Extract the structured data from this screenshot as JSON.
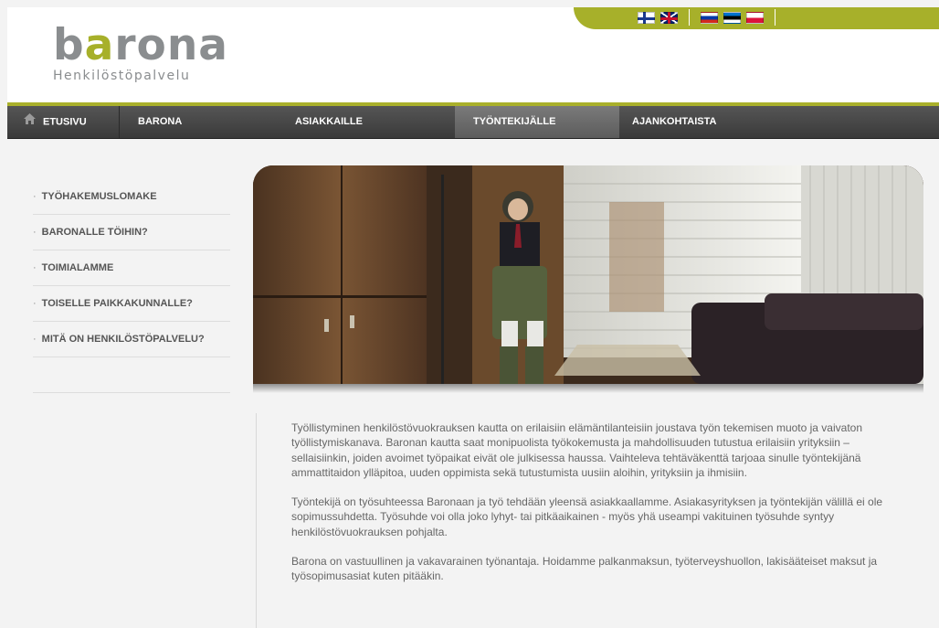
{
  "brand": {
    "name": "barona",
    "tagline": "Henkilöstöpalvelu",
    "colors": {
      "accent": "#a7b02a",
      "logo_gray": "#8a8d8f",
      "nav_bg": "#444444"
    }
  },
  "languages": [
    {
      "code": "fi",
      "icon": "flag-finland-icon"
    },
    {
      "code": "en",
      "icon": "flag-uk-icon"
    },
    {
      "code": "ru",
      "icon": "flag-russia-icon"
    },
    {
      "code": "et",
      "icon": "flag-estonia-icon"
    },
    {
      "code": "pl",
      "icon": "flag-poland-icon"
    }
  ],
  "nav": {
    "items": [
      {
        "label": "ETUSIVU",
        "icon": "home-icon",
        "active": false
      },
      {
        "label": "BARONA",
        "active": false
      },
      {
        "label": "ASIAKKAILLE",
        "active": false
      },
      {
        "label": "TYÖNTEKIJÄLLE",
        "active": true
      },
      {
        "label": "AJANKOHTAISTA",
        "active": false
      }
    ]
  },
  "sidebar": {
    "items": [
      {
        "label": "TYÖHAKEMUSLOMAKE"
      },
      {
        "label": "BARONALLE TÖIHIN?"
      },
      {
        "label": "TOIMIALAMME"
      },
      {
        "label": "TOISELLE PAIKKAKUNNALLE?"
      },
      {
        "label": "MITÄ ON HENKILÖSTÖPALVELU?"
      }
    ]
  },
  "hero": {
    "icon": "office-photo"
  },
  "content": {
    "paragraphs": [
      "Työllistyminen henkilöstövuokrauksen kautta on erilaisiin elämäntilanteisiin joustava työn tekemisen muoto ja vaivaton työllistymiskanava. Baronan kautta saat monipuolista työkokemusta ja mahdollisuuden tutustua erilaisiin yrityksiin – sellaisiinkin, joiden avoimet työpaikat eivät ole julkisessa haussa. Vaihteleva tehtäväkenttä tarjoaa sinulle työntekijänä ammattitaidon ylläpitoa, uuden oppimista sekä tutustumista uusiin aloihin, yrityksiin ja ihmisiin.",
      "Työntekijä on työsuhteessa Baronaan ja työ tehdään yleensä asiakkaallamme. Asiakasyrityksen ja työntekijän välillä ei ole sopimussuhdetta. Työsuhde voi olla joko lyhyt- tai pitkäaikainen - myös yhä useampi vakituinen työsuhde syntyy henkilöstövuokrauksen pohjalta.",
      "Barona on vastuullinen ja vakavarainen työnantaja. Hoidamme palkanmaksun, työterveyshuollon, lakisääteiset maksut ja työsopimusasiat kuten pitääkin."
    ]
  }
}
